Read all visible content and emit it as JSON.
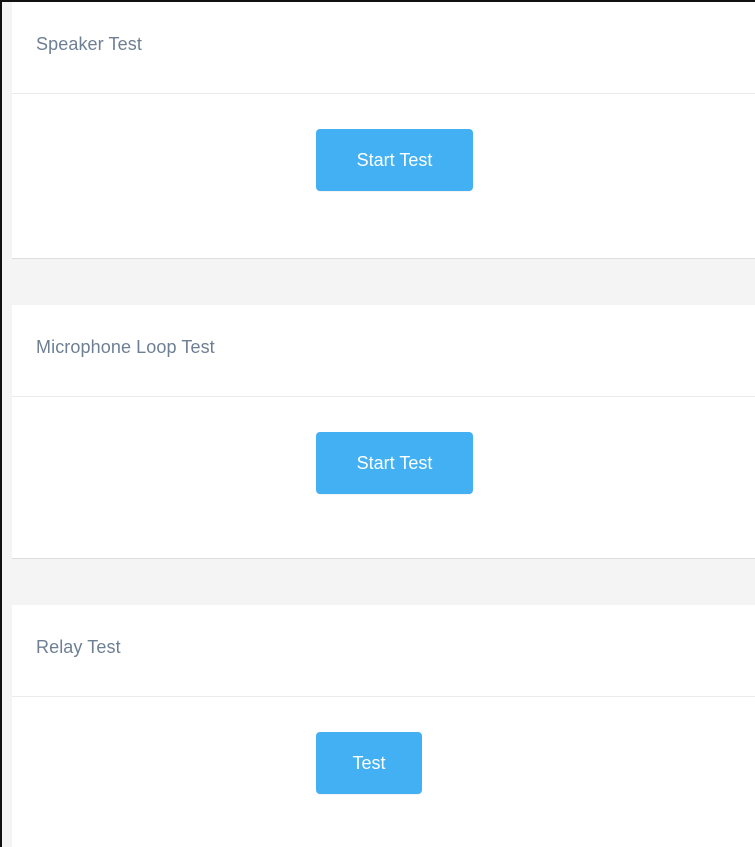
{
  "sections": [
    {
      "title": "Speaker Test",
      "button_label": "Start Test"
    },
    {
      "title": "Microphone Loop Test",
      "button_label": "Start Test"
    },
    {
      "title": "Relay Test",
      "button_label": "Test"
    }
  ],
  "colors": {
    "button_bg": "#42b0f3",
    "button_text": "#ffffff",
    "title_text": "#6e7f94",
    "page_bg": "#f4f4f4",
    "panel_bg": "#ffffff"
  }
}
